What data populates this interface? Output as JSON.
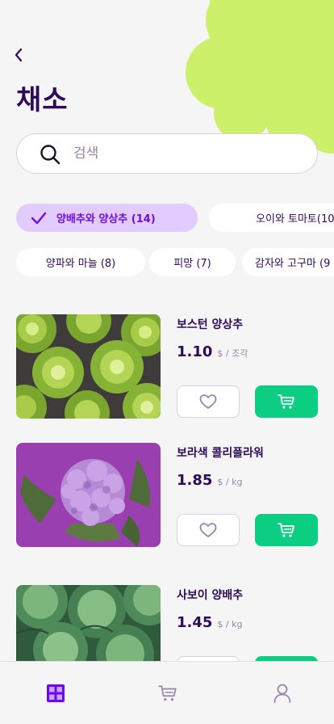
{
  "header": {
    "title": "채소",
    "back_icon": "chevron-left-icon"
  },
  "search": {
    "placeholder": "검색",
    "value": "",
    "icon": "search-icon"
  },
  "categories": [
    {
      "label": "양배추와 양상추 (14)",
      "selected": true
    },
    {
      "label": "오이와 토마토(10",
      "selected": false
    },
    {
      "label": "양파와 마늘 (8)",
      "selected": false
    },
    {
      "label": "피망 (7)",
      "selected": false
    },
    {
      "label": "감자와 고구마 (9",
      "selected": false
    }
  ],
  "products": [
    {
      "name": "보스턴 양상추",
      "price": "1.10",
      "unit": "$ / 조각"
    },
    {
      "name": "보라색 콜리플라워",
      "price": "1.85",
      "unit": "$ / kg"
    },
    {
      "name": "사보이 양배추",
      "price": "1.45",
      "unit": "$ / kg"
    }
  ],
  "tabbar": {
    "items": [
      {
        "icon": "grid-icon",
        "active": true
      },
      {
        "icon": "cart-icon",
        "active": false
      },
      {
        "icon": "user-icon",
        "active": false
      }
    ]
  },
  "colors": {
    "primary": "#2d0c57",
    "accent": "#6c0ee4",
    "chip_active_bg": "#e2cbff",
    "green": "#0bce83",
    "muted": "#9586a8",
    "blob": "#d0f1a0",
    "background": "#f6f5f5"
  }
}
